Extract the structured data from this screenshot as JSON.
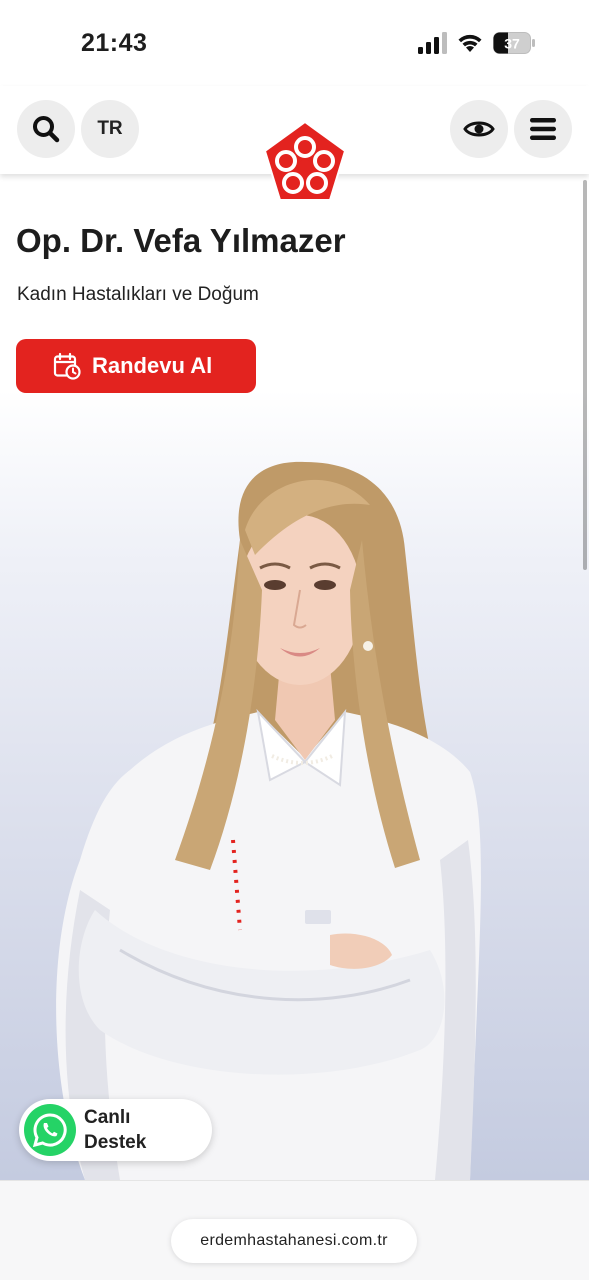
{
  "status_bar": {
    "time": "21:43",
    "battery": "37"
  },
  "header": {
    "language": "TR",
    "icons": [
      "search-icon",
      "eye-icon",
      "menu-icon",
      "hospital-logo"
    ]
  },
  "doctor": {
    "name": "Op. Dr. Vefa Yılmazer",
    "specialty": "Kadın Hastalıkları ve Doğum"
  },
  "appointment": {
    "label": "Randevu Al"
  },
  "support": {
    "line1": "Canlı",
    "line2": "Destek"
  },
  "browser": {
    "url": "erdemhastahanesi.com.tr"
  },
  "colors": {
    "brand_red": "#e3231f",
    "whatsapp_green": "#25d366"
  }
}
